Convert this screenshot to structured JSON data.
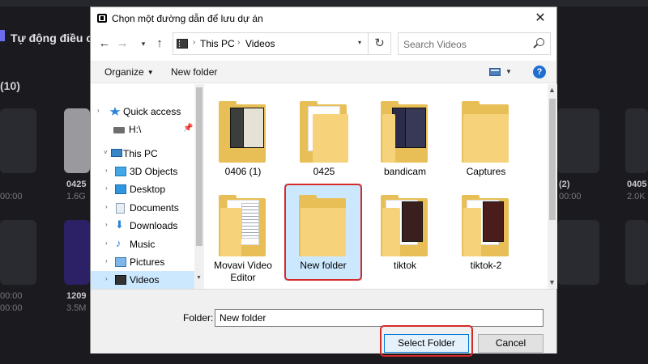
{
  "background": {
    "title": "Tự động điều chỉ",
    "count": "(10)",
    "items": [
      {
        "label": "0425",
        "sub": "1.6G"
      },
      {
        "label": "1209",
        "sub": "3.5M"
      },
      {
        "label": "(2)",
        "sub": "00:00"
      },
      {
        "label": "0405",
        "sub": "2.0K"
      }
    ],
    "durations": [
      "00:00",
      "00:00",
      "00:00"
    ]
  },
  "dialog": {
    "title": "Chọn một đường dẫn để lưu dự án",
    "address": {
      "segments": [
        "This PC",
        "Videos"
      ]
    },
    "search": {
      "placeholder": "Search Videos"
    },
    "toolbar": {
      "organize": "Organize",
      "new_folder": "New folder"
    },
    "nav": [
      {
        "label": "Quick access",
        "icon": "star-icon"
      },
      {
        "label": "H:\\",
        "icon": "drive-icon"
      },
      {
        "label": "This PC",
        "icon": "computer-icon"
      },
      {
        "label": "3D Objects",
        "icon": "cube-icon"
      },
      {
        "label": "Desktop",
        "icon": "desktop-icon"
      },
      {
        "label": "Documents",
        "icon": "document-icon"
      },
      {
        "label": "Downloads",
        "icon": "download-icon"
      },
      {
        "label": "Music",
        "icon": "music-icon"
      },
      {
        "label": "Pictures",
        "icon": "pictures-icon"
      },
      {
        "label": "Videos",
        "icon": "video-icon"
      }
    ],
    "files": [
      {
        "label": "0406 (1)"
      },
      {
        "label": "0425"
      },
      {
        "label": "bandicam"
      },
      {
        "label": "Captures"
      },
      {
        "label": "Movavi Video Editor"
      },
      {
        "label": "New folder",
        "selected": true
      },
      {
        "label": "tiktok"
      },
      {
        "label": "tiktok-2"
      }
    ],
    "folder_field": {
      "label": "Folder:",
      "value": "New folder"
    },
    "buttons": {
      "select": "Select Folder",
      "cancel": "Cancel"
    },
    "colors": {
      "selection": "#cce8ff",
      "highlight_frame": "#d42a2a",
      "folder": "#e8bf57"
    }
  }
}
